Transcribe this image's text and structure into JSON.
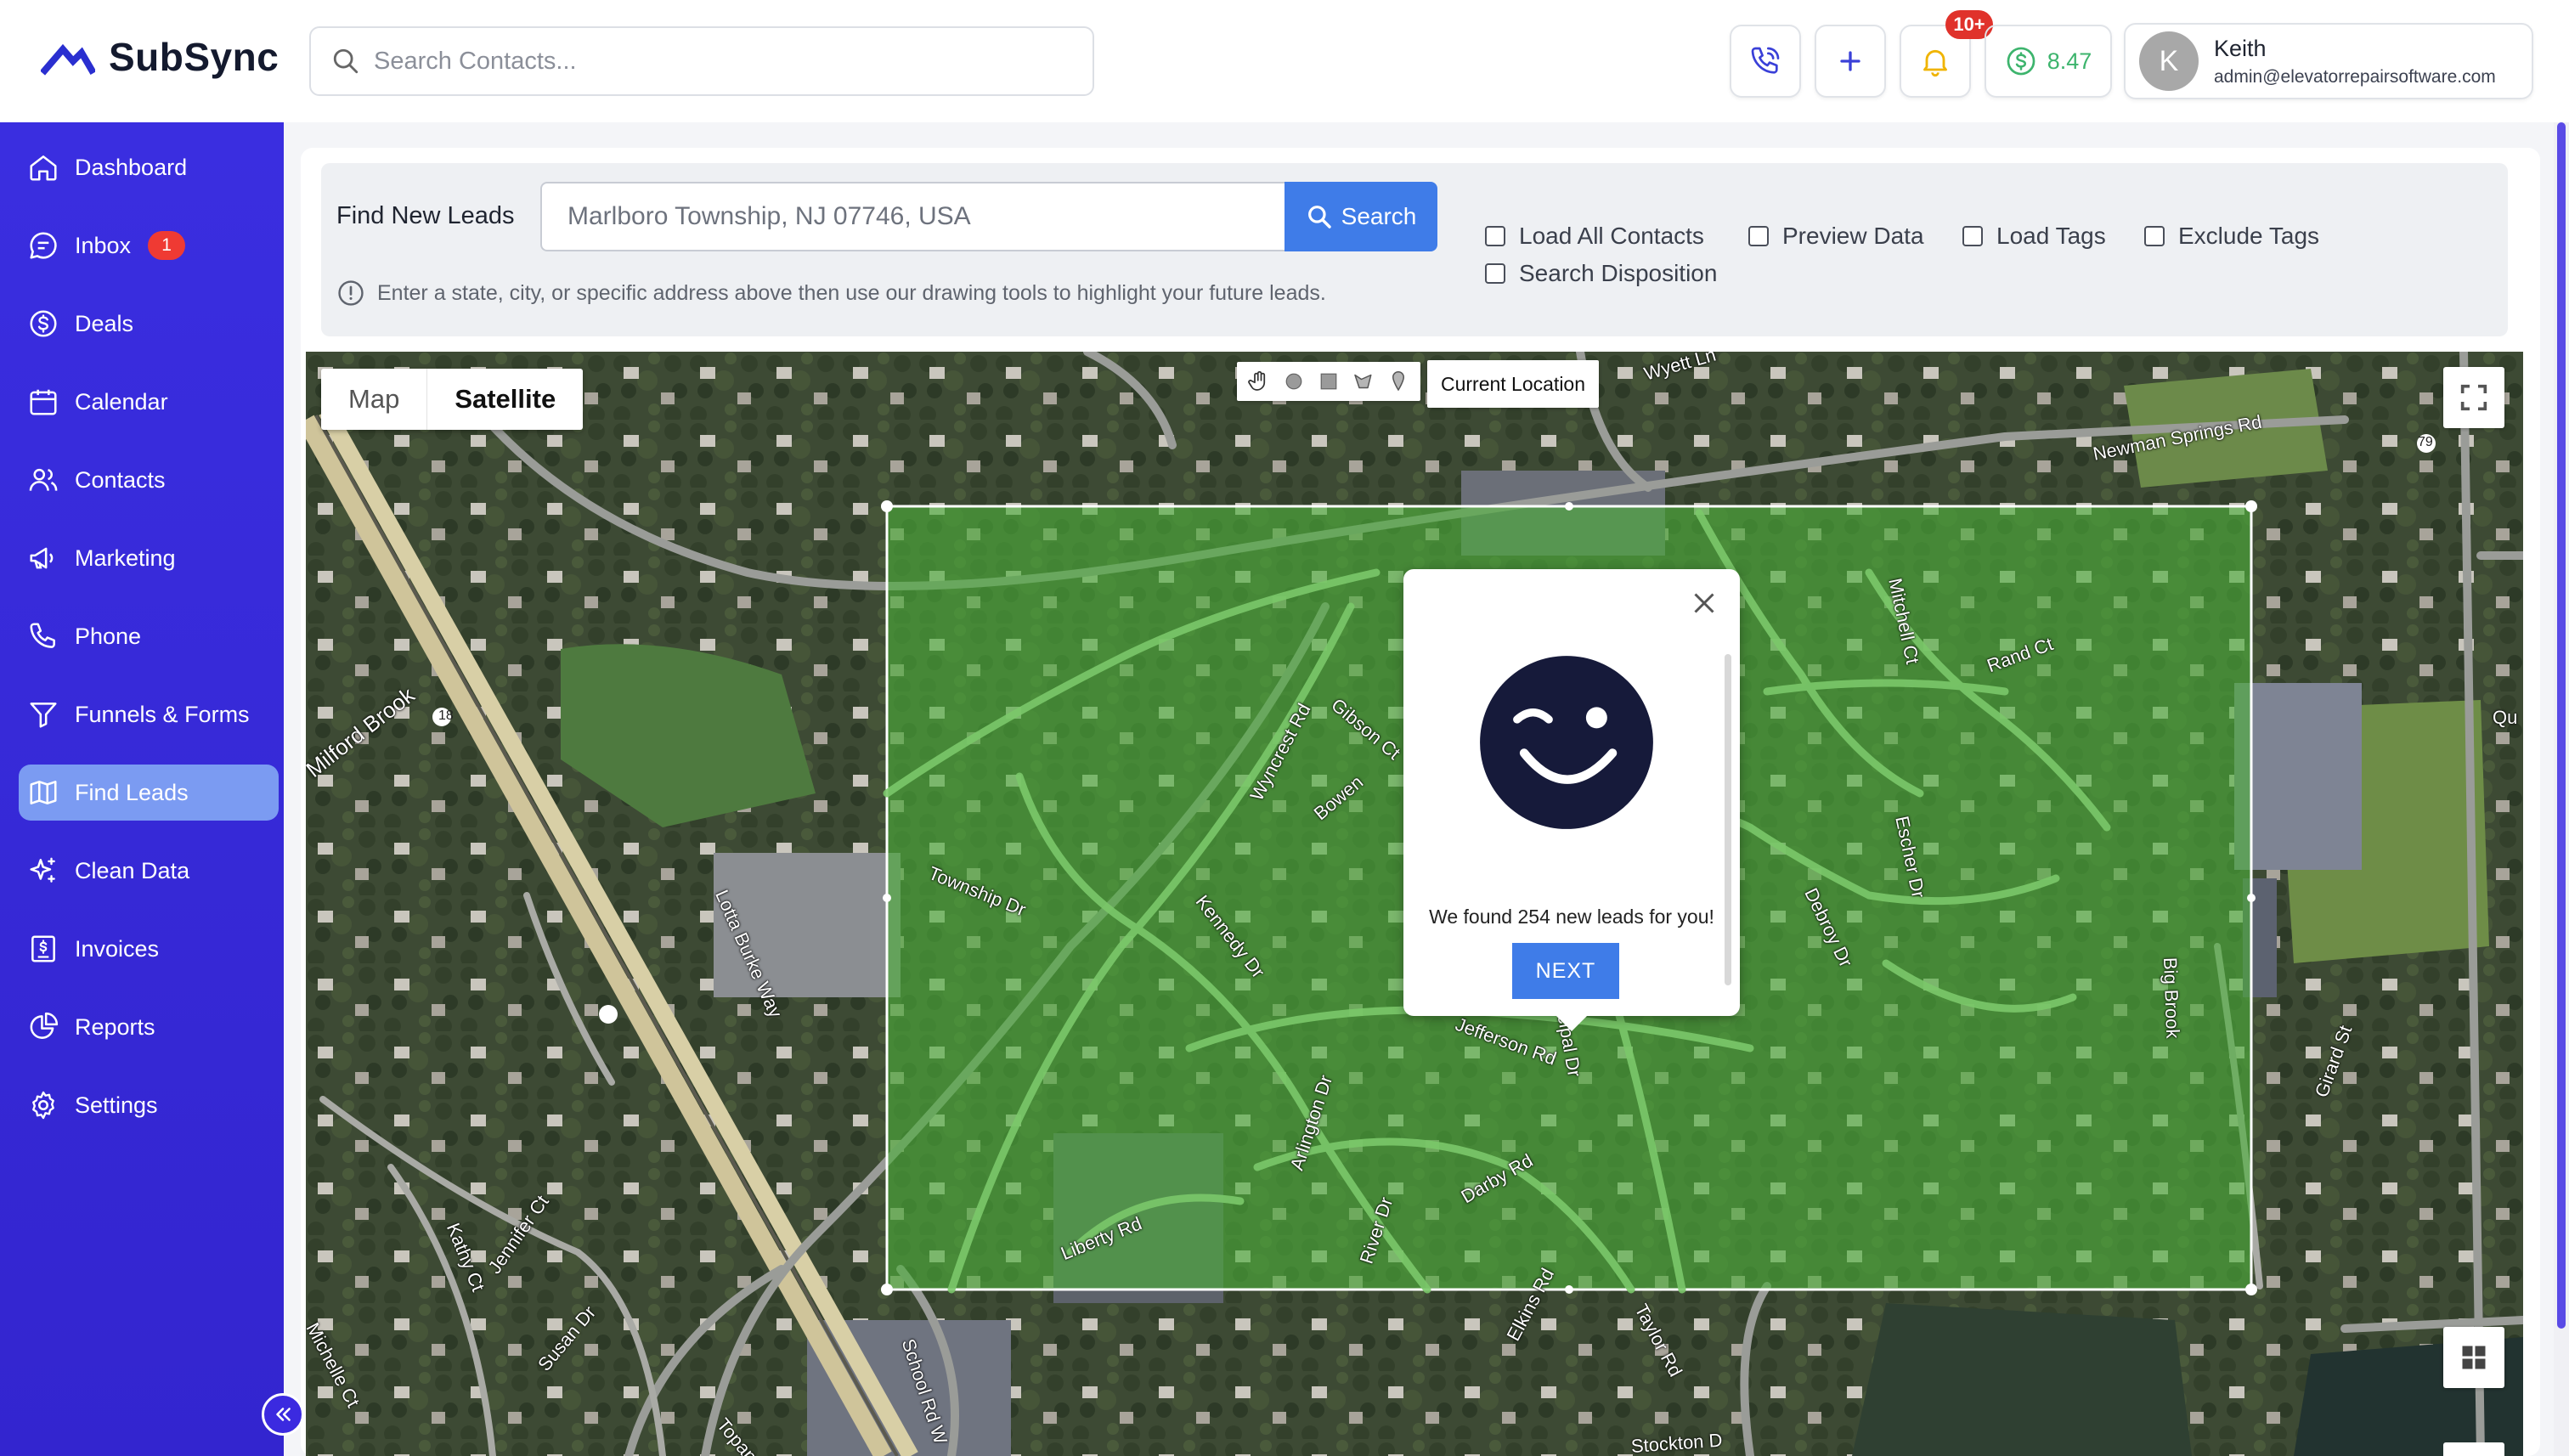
{
  "app": {
    "name": "SubSync"
  },
  "header": {
    "search_placeholder": "Search Contacts...",
    "notifications_badge": "10+",
    "balance": "8.47",
    "user": {
      "name": "Keith",
      "email": "admin@elevatorrepairsoftware.com",
      "initial": "K"
    }
  },
  "sidebar": {
    "items": [
      {
        "label": "Dashboard",
        "icon": "home-icon"
      },
      {
        "label": "Inbox",
        "icon": "chat-icon",
        "badge": "1"
      },
      {
        "label": "Deals",
        "icon": "dollar-circle-icon"
      },
      {
        "label": "Calendar",
        "icon": "calendar-icon"
      },
      {
        "label": "Contacts",
        "icon": "users-icon"
      },
      {
        "label": "Marketing",
        "icon": "megaphone-icon"
      },
      {
        "label": "Phone",
        "icon": "phone-icon"
      },
      {
        "label": "Funnels & Forms",
        "icon": "funnel-icon"
      },
      {
        "label": "Find Leads",
        "icon": "map-icon",
        "active": true
      },
      {
        "label": "Clean Data",
        "icon": "sparkle-icon"
      },
      {
        "label": "Invoices",
        "icon": "invoice-icon"
      },
      {
        "label": "Reports",
        "icon": "pie-chart-icon"
      },
      {
        "label": "Settings",
        "icon": "gear-icon"
      }
    ]
  },
  "find_leads": {
    "label": "Find New Leads",
    "location_value": "Marlboro Township, NJ 07746, USA",
    "search_button": "Search",
    "hint": "Enter a state, city, or specific address above then use our drawing tools to highlight your future leads.",
    "options": [
      {
        "label": "Load All Contacts",
        "checked": false
      },
      {
        "label": "Preview Data",
        "checked": false
      },
      {
        "label": "Load Tags",
        "checked": false
      },
      {
        "label": "Exclude Tags",
        "checked": false
      },
      {
        "label": "Search Disposition",
        "checked": false
      }
    ]
  },
  "map": {
    "type_map": "Map",
    "type_satellite": "Satellite",
    "current_location": "Current Location",
    "labels": [
      "Milford Brook",
      "Newman Springs Rd",
      "Wyett Ln",
      "Township Dr",
      "Kennedy Dr",
      "Wyncrest Rd",
      "Gibson Ct",
      "Jefferson Rd",
      "Arlington Dr",
      "Darby Rd",
      "River Dr",
      "Liberty Rd",
      "Lotta Burke Way",
      "Kathy Ct",
      "Jennifer Ct",
      "Susan Dr",
      "Michelle Ct",
      "Topanemus",
      "School Rd W",
      "Elkins Rd",
      "Taylor Rd",
      "Big Brook",
      "Girard St",
      "Debroy Dr",
      "Escher Dr",
      "Rand Ct",
      "Mitchell Ct",
      "Municipal Dr",
      "Bowen",
      "18",
      "79",
      "Qu",
      "Stockton D"
    ]
  },
  "popup": {
    "message": "We found 254 new leads for you!",
    "next": "NEXT"
  },
  "colors": {
    "sidebar": "#3b2ae0",
    "accent": "#3f7ce8",
    "active_nav": "#7b9bf2",
    "selection": "#4caf3a"
  }
}
